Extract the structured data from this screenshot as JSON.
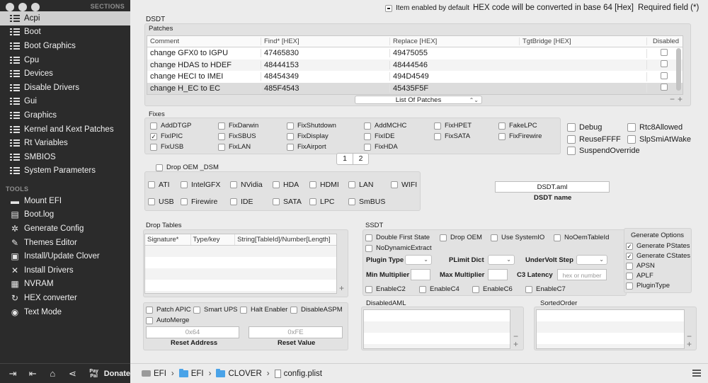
{
  "sidebar": {
    "sections_header": "SECTIONS",
    "tools_header": "TOOLS",
    "sections": [
      "Acpi",
      "Boot",
      "Boot Graphics",
      "Cpu",
      "Devices",
      "Disable Drivers",
      "Gui",
      "Graphics",
      "Kernel and Kext Patches",
      "Rt Variables",
      "SMBIOS",
      "System Parameters"
    ],
    "active_section": "Acpi",
    "tools": [
      {
        "label": "Mount EFI",
        "icon": "drive-icon"
      },
      {
        "label": "Boot.log",
        "icon": "document-icon"
      },
      {
        "label": "Generate Config",
        "icon": "gear-icon"
      },
      {
        "label": "Themes Editor",
        "icon": "theme-icon"
      },
      {
        "label": "Install/Update Clover",
        "icon": "package-icon"
      },
      {
        "label": "Install Drivers",
        "icon": "wrench-icon"
      },
      {
        "label": "NVRAM",
        "icon": "chip-icon"
      },
      {
        "label": "HEX converter",
        "icon": "refresh-icon"
      },
      {
        "label": "Text Mode",
        "icon": "eye-icon"
      }
    ],
    "donate_label": "Donate",
    "paypal_text": "Pay Pal"
  },
  "topbar": {
    "item_enabled_default": "Item enabled by default",
    "hex_note": "HEX code will be converted in base 64 [Hex]",
    "required_field": "Required field (*)"
  },
  "dsdt": {
    "label": "DSDT",
    "patches_label": "Patches",
    "patch_columns": [
      "Comment",
      "Find* [HEX]",
      "Replace [HEX]",
      "TgtBridge [HEX]",
      "Disabled"
    ],
    "patches": [
      {
        "comment": "change GFX0 to IGPU",
        "find": "47465830",
        "replace": "49475055",
        "tgt": ""
      },
      {
        "comment": "change HDAS to HDEF",
        "find": "48444153",
        "replace": "48444546",
        "tgt": ""
      },
      {
        "comment": "change HECI to IMEI",
        "find": "48454349",
        "replace": "494D4549",
        "tgt": ""
      },
      {
        "comment": "change H_EC to EC",
        "find": "485F4543",
        "replace": "45435F5F",
        "tgt": ""
      }
    ],
    "list_of_patches": "List Of Patches",
    "fixes_label": "Fixes",
    "fixes": [
      [
        "AddDTGP",
        "FixDarwin",
        "FixShutdown",
        "AddMCHC",
        "FixHPET",
        "FakeLPC"
      ],
      [
        "FixIPIC",
        "FixSBUS",
        "FixDisplay",
        "FixIDE",
        "FixSATA",
        "FixFirewire"
      ],
      [
        "FixUSB",
        "FixLAN",
        "FixAirport",
        "FixHDA",
        "",
        ""
      ]
    ],
    "checked_fix": "FixIPIC",
    "pages": [
      "1",
      "2"
    ],
    "right_options": [
      [
        "Debug",
        "Rtc8Allowed"
      ],
      [
        "ReuseFFFF",
        "SlpSmiAtWake"
      ],
      [
        "SuspendOverride",
        ""
      ]
    ],
    "drop_oem_dsm": "Drop OEM _DSM",
    "dsm_items": [
      [
        "ATI",
        "IntelGFX",
        "NVidia",
        "HDA",
        "HDMI",
        "LAN",
        "WIFI"
      ],
      [
        "USB",
        "Firewire",
        "IDE",
        "SATA",
        "LPC",
        "SmBUS",
        ""
      ]
    ],
    "dsdt_name_value": "DSDT.aml",
    "dsdt_name_label": "DSDT name"
  },
  "drop_tables": {
    "label": "Drop Tables",
    "columns": [
      "Signature*",
      "Type/key",
      "String[TableId]/Number[Length]"
    ]
  },
  "bottom_left": {
    "options": [
      [
        "Patch APIC",
        "Smart UPS",
        "Halt Enabler",
        "DisableASPM"
      ],
      [
        "AutoMerge",
        "",
        "",
        ""
      ]
    ],
    "reset_address_placeholder": "0x64",
    "reset_value_placeholder": "0xFE",
    "reset_address_label": "Reset Address",
    "reset_value_label": "Reset Value"
  },
  "ssdt": {
    "label": "SSDT",
    "row1": [
      "Double First State",
      "Drop OEM",
      "Use SystemIO",
      "NoOemTableId"
    ],
    "row2": "NoDynamicExtract",
    "plugin_type": "Plugin Type",
    "plimit_dict": "PLimit Dict",
    "undervolt_step": "UnderVolt Step",
    "min_multiplier": "Min Multiplier",
    "max_multiplier": "Max Multiplier",
    "c3_latency": "C3 Latency",
    "c3_placeholder": "hex or number",
    "enable_c": [
      "EnableC2",
      "EnableC4",
      "EnableC6",
      "EnableC7"
    ],
    "generate_options_label": "Generate Options",
    "generate_options": [
      {
        "label": "Generate PStates",
        "checked": true
      },
      {
        "label": "Generate CStates",
        "checked": true
      },
      {
        "label": "APSN",
        "checked": false
      },
      {
        "label": "APLF",
        "checked": false
      },
      {
        "label": "PluginType",
        "checked": false
      }
    ]
  },
  "disabled_aml": {
    "label": "DisabledAML"
  },
  "sorted_order": {
    "label": "SortedOrder"
  },
  "footer": {
    "path": [
      "EFI",
      "EFI",
      "CLOVER",
      "config.plist"
    ]
  }
}
